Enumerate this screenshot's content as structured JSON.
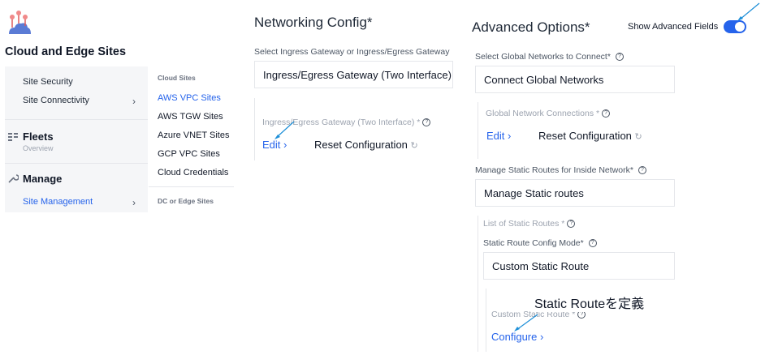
{
  "app": {
    "title": "Cloud and Edge Sites",
    "logo_icon": "edge-network-logo"
  },
  "sidebar": {
    "items": [
      {
        "label": "Site Security"
      },
      {
        "label": "Site Connectivity"
      }
    ],
    "fleets": {
      "label": "Fleets",
      "sub": "Overview",
      "icon": "fleets-icon"
    },
    "manage": {
      "label": "Manage",
      "icon": "wrench-icon"
    },
    "site_management": {
      "label": "Site Management"
    }
  },
  "submenu": {
    "cloud_heading": "Cloud Sites",
    "cloud_items": [
      "AWS VPC Sites",
      "AWS TGW Sites",
      "Azure VNET Sites",
      "GCP VPC Sites",
      "Cloud Credentials"
    ],
    "dc_heading": "DC or Edge Sites"
  },
  "networking": {
    "title": "Networking Config",
    "required_mark": "*",
    "select_label": "Select Ingress Gateway or Ingress/Egress Gateway",
    "select_value": "Ingress/Egress Gateway (Two Interface)",
    "section_label": "Ingress/Egress Gateway (Two Interface) *",
    "edit_label": "Edit",
    "reset_label": "Reset Configuration"
  },
  "advanced": {
    "title": "Advanced Options",
    "required_mark": "*",
    "show_fields_label": "Show Advanced Fields",
    "show_fields_on": true,
    "global_label": "Select Global Networks to Connect*",
    "global_value": "Connect Global Networks",
    "global_conn_label": "Global Network Connections *",
    "edit_label": "Edit",
    "reset_label": "Reset Configuration",
    "static_label": "Manage Static Routes for Inside Network*",
    "static_value": "Manage Static routes",
    "list_label": "List of Static Routes *",
    "mode_label": "Static Route Config Mode*",
    "mode_value": "Custom Static Route",
    "custom_label": "Custom Static Route *",
    "configure_label": "Configure"
  },
  "annotation": {
    "text": "Static Routeを定義"
  },
  "colors": {
    "accent": "#2563eb",
    "annotation_arrow": "#1d8fd8"
  }
}
